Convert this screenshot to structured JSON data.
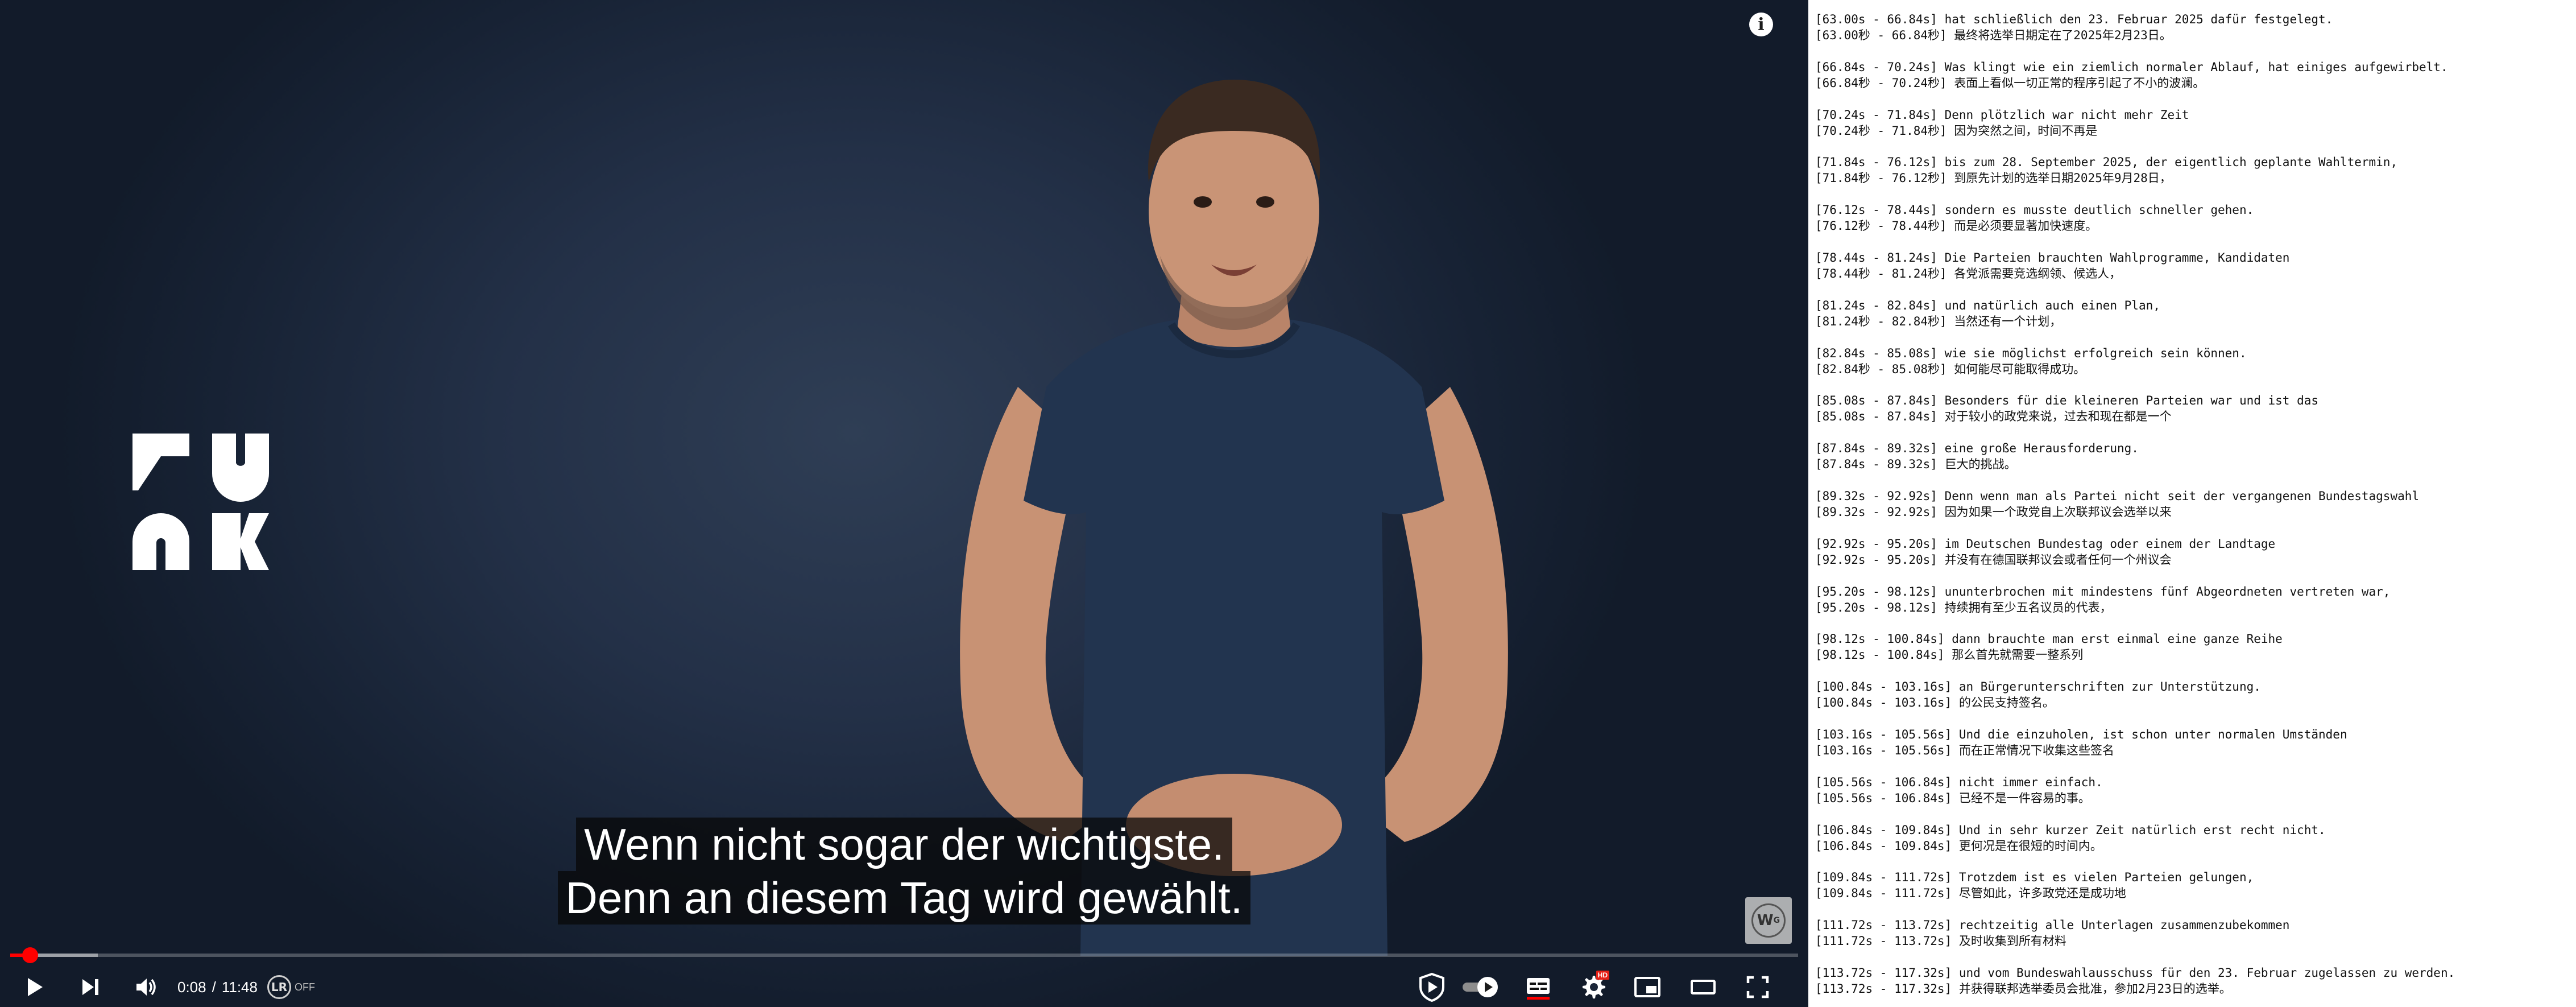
{
  "player": {
    "captions": [
      "Wenn nicht sogar der wichtigste.",
      "Denn an diesem Tag wird gewählt."
    ],
    "time": {
      "current": "0:08",
      "separator": "/",
      "duration": "11:48"
    },
    "progress": {
      "played_fraction": 0.011,
      "buffered_fraction": 0.049
    },
    "language_reactor": {
      "icon_text": "LR",
      "status": "OFF"
    },
    "settings_badge": "HD",
    "watermark_text": "W_G",
    "logo": "FUNK",
    "colors": {
      "accent": "#ff0000",
      "background": "#1b2638",
      "shirt": "#22344f"
    }
  },
  "transcript": [
    {
      "de": "[63.00s - 66.84s] hat schließlich den 23. Februar 2025 dafür festgelegt.",
      "zh": "[63.00秒 - 66.84秒] 最终将选举日期定在了2025年2月23日。"
    },
    {
      "de": "[66.84s - 70.24s] Was klingt wie ein ziemlich normaler Ablauf, hat einiges aufgewirbelt.",
      "zh": "[66.84秒 - 70.24秒] 表面上看似一切正常的程序引起了不小的波澜。"
    },
    {
      "de": "[70.24s - 71.84s] Denn plötzlich war nicht mehr Zeit",
      "zh": "[70.24秒 - 71.84秒] 因为突然之间，时间不再是"
    },
    {
      "de": "[71.84s - 76.12s] bis zum 28. September 2025, der eigentlich geplante Wahltermin,",
      "zh": "[71.84秒 - 76.12秒] 到原先计划的选举日期2025年9月28日，"
    },
    {
      "de": "[76.12s - 78.44s] sondern es musste deutlich schneller gehen.",
      "zh": "[76.12秒 - 78.44秒] 而是必须要显著加快速度。"
    },
    {
      "de": "[78.44s - 81.24s] Die Parteien brauchten Wahlprogramme, Kandidaten",
      "zh": "[78.44秒 - 81.24秒] 各党派需要竞选纲领、候选人，"
    },
    {
      "de": "[81.24s - 82.84s] und natürlich auch einen Plan,",
      "zh": "[81.24秒 - 82.84秒] 当然还有一个计划，"
    },
    {
      "de": "[82.84s - 85.08s] wie sie möglichst erfolgreich sein können.",
      "zh": "[82.84秒 - 85.08秒] 如何能尽可能取得成功。"
    },
    {
      "de": "[85.08s - 87.84s] Besonders für die kleineren Parteien war und ist das",
      "zh": "[85.08s - 87.84s] 对于较小的政党来说，过去和现在都是一个"
    },
    {
      "de": "[87.84s - 89.32s] eine große Herausforderung.",
      "zh": "[87.84s - 89.32s] 巨大的挑战。"
    },
    {
      "de": "[89.32s - 92.92s] Denn wenn man als Partei nicht seit der vergangenen Bundestagswahl",
      "zh": "[89.32s - 92.92s] 因为如果一个政党自上次联邦议会选举以来"
    },
    {
      "de": "[92.92s - 95.20s] im Deutschen Bundestag oder einem der Landtage",
      "zh": "[92.92s - 95.20s] 并没有在德国联邦议会或者任何一个州议会"
    },
    {
      "de": "[95.20s - 98.12s] ununterbrochen mit mindestens fünf Abgeordneten vertreten war,",
      "zh": "[95.20s - 98.12s] 持续拥有至少五名议员的代表，"
    },
    {
      "de": "[98.12s - 100.84s] dann brauchte man erst einmal eine ganze Reihe",
      "zh": "[98.12s - 100.84s] 那么首先就需要一整系列"
    },
    {
      "de": "[100.84s - 103.16s] an Bürgerunterschriften zur Unterstützung.",
      "zh": "[100.84s - 103.16s] 的公民支持签名。"
    },
    {
      "de": "[103.16s - 105.56s] Und die einzuholen, ist schon unter normalen Umständen",
      "zh": "[103.16s - 105.56s] 而在正常情况下收集这些签名"
    },
    {
      "de": "[105.56s - 106.84s] nicht immer einfach.",
      "zh": "[105.56s - 106.84s] 已经不是一件容易的事。"
    },
    {
      "de": "[106.84s - 109.84s] Und in sehr kurzer Zeit natürlich erst recht nicht.",
      "zh": "[106.84s - 109.84s] 更何况是在很短的时间内。"
    },
    {
      "de": "[109.84s - 111.72s] Trotzdem ist es vielen Parteien gelungen,",
      "zh": "[109.84s - 111.72s] 尽管如此，许多政党还是成功地"
    },
    {
      "de": "[111.72s - 113.72s] rechtzeitig alle Unterlagen zusammenzubekommen",
      "zh": "[111.72s - 113.72s] 及时收集到所有材料"
    },
    {
      "de": "[113.72s - 117.32s] und vom Bundeswahlausschuss für den 23. Februar zugelassen zu werden.",
      "zh": "[113.72s - 117.32s] 并获得联邦选举委员会批准，参加2月23日的选举。"
    }
  ]
}
